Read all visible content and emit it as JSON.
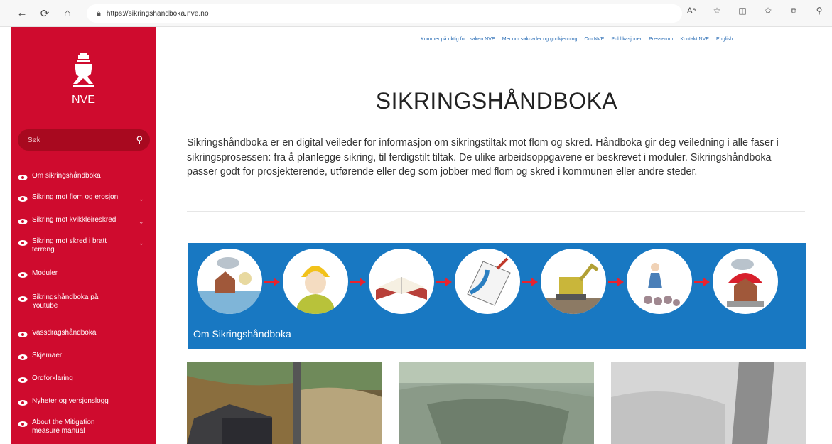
{
  "browser": {
    "url": "https://sikringshandboka.nve.no",
    "icons": [
      "back-icon",
      "refresh-icon",
      "home-icon",
      "read-aloud-icon",
      "favorite-icon",
      "split-screen-icon",
      "favorites-icon",
      "collections-icon",
      "extensions-icon"
    ]
  },
  "sidebar": {
    "logo_text": "NVE",
    "search_placeholder": "Søk",
    "items": [
      {
        "label": "Om sikringshåndboka",
        "has_children": false
      },
      {
        "label": "Sikring mot flom og erosjon",
        "has_children": true
      },
      {
        "label": "Sikring mot kvikkleireskred",
        "has_children": true
      },
      {
        "label": "Sikring mot skred i bratt terreng",
        "has_children": true
      },
      {
        "label": "Moduler",
        "has_children": false
      },
      {
        "label": "Sikringshåndboka på Youtube",
        "has_children": false
      },
      {
        "label": "Vassdragshåndboka",
        "has_children": false
      },
      {
        "label": "Skjemaer",
        "has_children": false
      },
      {
        "label": "Ordforklaring",
        "has_children": false
      },
      {
        "label": "Nyheter og versjonslogg",
        "has_children": false
      },
      {
        "label": "About the Mitigation measure manual",
        "has_children": false
      }
    ]
  },
  "toplinks": [
    "Kommer på riktig fot i saken NVE",
    "Mer om søknader og godkjenning",
    "Om NVE",
    "Publikasjoner",
    "Presserom",
    "Kontakt NVE",
    "English"
  ],
  "main": {
    "title": "SIKRINGSHÅNDBOKA",
    "intro": "Sikringshåndboka er en digital veileder for informasjon om sikringstiltak mot flom og skred. Håndboka gir deg veiledning i alle faser i sikringsprosessen: fra å planlegge sikring, til ferdigstilt tiltak. De ulike arbeidsoppgavene er beskrevet i moduler. Sikringshåndboka passer godt for prosjekterende, utførende eller deg som jobber med flom og skred i kommunen eller andre steder.",
    "banner_label": "Om Sikringshåndboka",
    "colors": {
      "accent": "#cf0b2e",
      "banner": "#1878c2",
      "link": "#2a6db5"
    }
  }
}
